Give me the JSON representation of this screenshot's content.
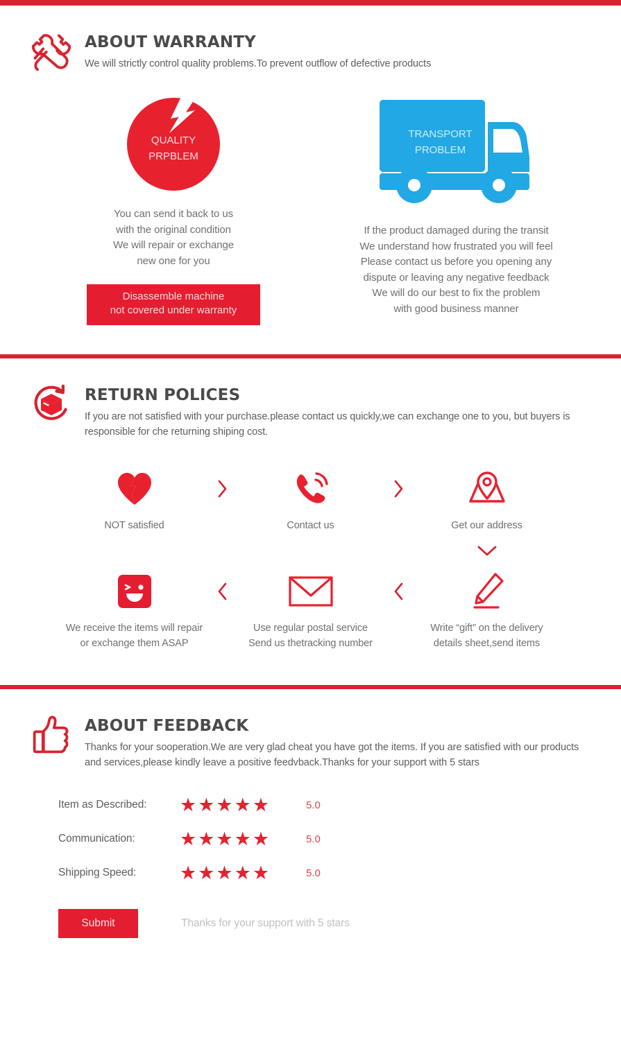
{
  "colors": {
    "brand_red": "#d8232f",
    "button_red": "#e51d30",
    "star_red": "#e8212f",
    "truck_blue": "#21a8e5",
    "body_gray": "#6f6f6f",
    "title_gray": "#4a4a4a"
  },
  "warranty": {
    "icon": "crossed-wrenches-icon",
    "title": "ABOUT WARRANTY",
    "subtitle": "We will strictly control quality problems.To prevent outflow of defective products",
    "quality": {
      "icon": "cracked-circle-icon",
      "badge_line1": "QUALITY",
      "badge_line2": "PRPBLEM",
      "text": "You can send it back to us\nwith the original condition\nWe will repair or exchange\nnew one for you",
      "button_line1": "Disassemble machine",
      "button_line2": "not covered under warranty"
    },
    "transport": {
      "icon": "delivery-truck-icon",
      "badge_line1": "TRANSPORT",
      "badge_line2": "PROBLEM",
      "text": "If the product damaged during the transit\nWe understand how  frustrated you will feel\nPlease contact us before you opening any\ndispute or leaving any negative feedback\nWe will do our best to fix the problem\nwith good business manner"
    }
  },
  "returns": {
    "icon": "return-box-icon",
    "title": "RETURN POLICES",
    "subtitle": "If you are not satisfied with your purchase.please contact us quickly,we can exchange one to you, but buyers is responsible for che returning shiping cost.",
    "steps_row1": [
      {
        "icon": "broken-heart-icon",
        "label": "NOT satisfied"
      },
      {
        "icon": "phone-call-icon",
        "label": "Contact us"
      },
      {
        "icon": "map-location-pin-icon",
        "label": "Get our address"
      }
    ],
    "steps_row2": [
      {
        "icon": "smiley-face-icon",
        "label": "We receive the items will repair\nor exchange them ASAP"
      },
      {
        "icon": "envelope-icon",
        "label": "Use regular postal service\nSend us thetracking number"
      },
      {
        "icon": "pencil-icon",
        "label": "Write  “gift”  on the delivery\ndetails sheet,send items"
      }
    ],
    "arrow_right": "chevron-right-icon",
    "arrow_left": "chevron-left-icon",
    "arrow_down": "chevron-down-icon"
  },
  "feedback": {
    "icon": "thumbs-up-icon",
    "title": "ABOUT FEEDBACK",
    "subtitle": "Thanks for your sooperation.We are very glad cheat you have got the items. If you are satisfied with our products and services,please kindly leave a positive feedvback.Thanks for your support with 5 stars",
    "ratings": [
      {
        "label": "Item as Described:",
        "stars": 5,
        "value": "5.0"
      },
      {
        "label": "Communication:",
        "stars": 5,
        "value": "5.0"
      },
      {
        "label": "Shipping Speed:",
        "stars": 5,
        "value": "5.0"
      }
    ],
    "star_glyph": "★",
    "submit_label": "Submit",
    "submit_hint": "Thanks for your support with 5 stars"
  }
}
